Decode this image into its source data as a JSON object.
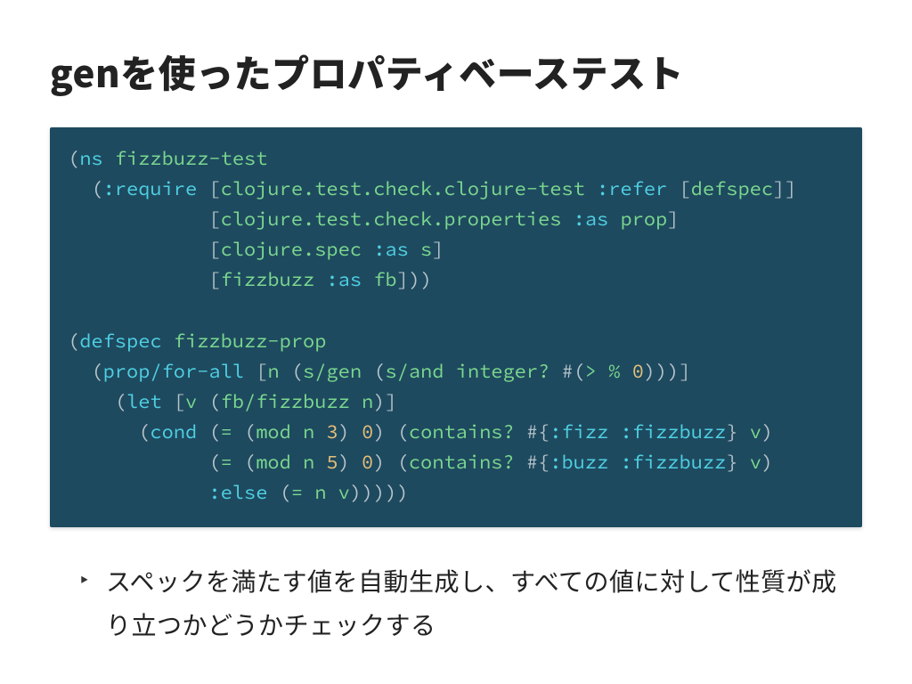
{
  "title": "genを使ったプロパティベーステスト",
  "code_lines": [
    [
      {
        "t": "(",
        "c": "tok-punc"
      },
      {
        "t": "ns",
        "c": "tok-kw"
      },
      {
        "t": " ",
        "c": ""
      },
      {
        "t": "fizzbuzz-test",
        "c": "tok-fn"
      }
    ],
    [
      {
        "t": "  (",
        "c": "tok-punc"
      },
      {
        "t": ":require",
        "c": "tok-kw"
      },
      {
        "t": " [",
        "c": "tok-punc"
      },
      {
        "t": "clojure.test.check.clojure-test",
        "c": "tok-fn"
      },
      {
        "t": " ",
        "c": ""
      },
      {
        "t": ":refer",
        "c": "tok-kw"
      },
      {
        "t": " [",
        "c": "tok-punc"
      },
      {
        "t": "defspec",
        "c": "tok-fn"
      },
      {
        "t": "]]",
        "c": "tok-punc"
      }
    ],
    [
      {
        "t": "            [",
        "c": "tok-punc"
      },
      {
        "t": "clojure.test.check.properties",
        "c": "tok-fn"
      },
      {
        "t": " ",
        "c": ""
      },
      {
        "t": ":as",
        "c": "tok-kw"
      },
      {
        "t": " ",
        "c": ""
      },
      {
        "t": "prop",
        "c": "tok-fn"
      },
      {
        "t": "]",
        "c": "tok-punc"
      }
    ],
    [
      {
        "t": "            [",
        "c": "tok-punc"
      },
      {
        "t": "clojure.spec",
        "c": "tok-fn"
      },
      {
        "t": " ",
        "c": ""
      },
      {
        "t": ":as",
        "c": "tok-kw"
      },
      {
        "t": " ",
        "c": ""
      },
      {
        "t": "s",
        "c": "tok-fn"
      },
      {
        "t": "]",
        "c": "tok-punc"
      }
    ],
    [
      {
        "t": "            [",
        "c": "tok-punc"
      },
      {
        "t": "fizzbuzz",
        "c": "tok-fn"
      },
      {
        "t": " ",
        "c": ""
      },
      {
        "t": ":as",
        "c": "tok-kw"
      },
      {
        "t": " ",
        "c": ""
      },
      {
        "t": "fb",
        "c": "tok-fn"
      },
      {
        "t": "]))",
        "c": "tok-punc"
      }
    ],
    [
      {
        "t": " ",
        "c": ""
      }
    ],
    [
      {
        "t": "(",
        "c": "tok-punc"
      },
      {
        "t": "defspec",
        "c": "tok-kw"
      },
      {
        "t": " ",
        "c": ""
      },
      {
        "t": "fizzbuzz-prop",
        "c": "tok-fn"
      }
    ],
    [
      {
        "t": "  (",
        "c": "tok-punc"
      },
      {
        "t": "prop/for-all",
        "c": "tok-kw"
      },
      {
        "t": " [",
        "c": "tok-punc"
      },
      {
        "t": "n",
        "c": "tok-fn"
      },
      {
        "t": " (",
        "c": "tok-punc"
      },
      {
        "t": "s/gen",
        "c": "tok-fn"
      },
      {
        "t": " (",
        "c": "tok-punc"
      },
      {
        "t": "s/and",
        "c": "tok-fn"
      },
      {
        "t": " ",
        "c": ""
      },
      {
        "t": "integer?",
        "c": "tok-fn"
      },
      {
        "t": " ",
        "c": ""
      },
      {
        "t": "#(",
        "c": "tok-punc"
      },
      {
        "t": ">",
        "c": "tok-fn"
      },
      {
        "t": " ",
        "c": ""
      },
      {
        "t": "%",
        "c": "tok-fn"
      },
      {
        "t": " ",
        "c": ""
      },
      {
        "t": "0",
        "c": "tok-num"
      },
      {
        "t": ")))]",
        "c": "tok-punc"
      }
    ],
    [
      {
        "t": "    (",
        "c": "tok-punc"
      },
      {
        "t": "let",
        "c": "tok-kw"
      },
      {
        "t": " [",
        "c": "tok-punc"
      },
      {
        "t": "v",
        "c": "tok-fn"
      },
      {
        "t": " (",
        "c": "tok-punc"
      },
      {
        "t": "fb/fizzbuzz",
        "c": "tok-fn"
      },
      {
        "t": " ",
        "c": ""
      },
      {
        "t": "n",
        "c": "tok-fn"
      },
      {
        "t": ")]",
        "c": "tok-punc"
      }
    ],
    [
      {
        "t": "      (",
        "c": "tok-punc"
      },
      {
        "t": "cond",
        "c": "tok-kw"
      },
      {
        "t": " (",
        "c": "tok-punc"
      },
      {
        "t": "=",
        "c": "tok-fn"
      },
      {
        "t": " (",
        "c": "tok-punc"
      },
      {
        "t": "mod",
        "c": "tok-fn"
      },
      {
        "t": " ",
        "c": ""
      },
      {
        "t": "n",
        "c": "tok-fn"
      },
      {
        "t": " ",
        "c": ""
      },
      {
        "t": "3",
        "c": "tok-num"
      },
      {
        "t": ") ",
        "c": "tok-punc"
      },
      {
        "t": "0",
        "c": "tok-num"
      },
      {
        "t": ") (",
        "c": "tok-punc"
      },
      {
        "t": "contains?",
        "c": "tok-fn"
      },
      {
        "t": " ",
        "c": ""
      },
      {
        "t": "#{",
        "c": "tok-punc"
      },
      {
        "t": ":fizz",
        "c": "tok-kw"
      },
      {
        "t": " ",
        "c": ""
      },
      {
        "t": ":fizzbuzz",
        "c": "tok-kw"
      },
      {
        "t": "}",
        "c": "tok-punc"
      },
      {
        "t": " ",
        "c": ""
      },
      {
        "t": "v",
        "c": "tok-fn"
      },
      {
        "t": ")",
        "c": "tok-punc"
      }
    ],
    [
      {
        "t": "            (",
        "c": "tok-punc"
      },
      {
        "t": "=",
        "c": "tok-fn"
      },
      {
        "t": " (",
        "c": "tok-punc"
      },
      {
        "t": "mod",
        "c": "tok-fn"
      },
      {
        "t": " ",
        "c": ""
      },
      {
        "t": "n",
        "c": "tok-fn"
      },
      {
        "t": " ",
        "c": ""
      },
      {
        "t": "5",
        "c": "tok-num"
      },
      {
        "t": ") ",
        "c": "tok-punc"
      },
      {
        "t": "0",
        "c": "tok-num"
      },
      {
        "t": ") (",
        "c": "tok-punc"
      },
      {
        "t": "contains?",
        "c": "tok-fn"
      },
      {
        "t": " ",
        "c": ""
      },
      {
        "t": "#{",
        "c": "tok-punc"
      },
      {
        "t": ":buzz",
        "c": "tok-kw"
      },
      {
        "t": " ",
        "c": ""
      },
      {
        "t": ":fizzbuzz",
        "c": "tok-kw"
      },
      {
        "t": "}",
        "c": "tok-punc"
      },
      {
        "t": " ",
        "c": ""
      },
      {
        "t": "v",
        "c": "tok-fn"
      },
      {
        "t": ")",
        "c": "tok-punc"
      }
    ],
    [
      {
        "t": "            ",
        "c": ""
      },
      {
        "t": ":else",
        "c": "tok-kw"
      },
      {
        "t": " (",
        "c": "tok-punc"
      },
      {
        "t": "=",
        "c": "tok-fn"
      },
      {
        "t": " ",
        "c": ""
      },
      {
        "t": "n",
        "c": "tok-fn"
      },
      {
        "t": " ",
        "c": ""
      },
      {
        "t": "v",
        "c": "tok-fn"
      },
      {
        "t": ")))))",
        "c": "tok-punc"
      }
    ]
  ],
  "bullet_mark": "‣",
  "bullet_text": "スペックを満たす値を自動生成し、すべての値に対して性質が成り立つかどうかチェックする"
}
